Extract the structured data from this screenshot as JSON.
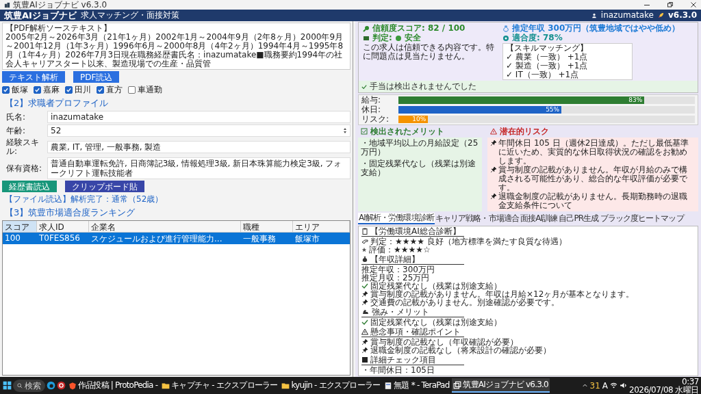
{
  "title_bar": {
    "title": "筑豊AIジョブナビ v6.3.0"
  },
  "header": {
    "title": "筑豊AIジョブナビ",
    "subtitle": "求人マッチング・面接対策",
    "user": "inazumatake",
    "version": "v6.3.0"
  },
  "source_text": {
    "heading": "【PDF解析ソーステキスト】",
    "body": "2005年2月～2026年3月（21年1ヶ月）2002年1月～2004年9月（2年8ヶ月）2000年9月～2001年12月（1年3ヶ月）1996年6月～2000年8月（4年2ヶ月）1994年4月～1995年8月（1年4ヶ月）2026年7月3日現在職務経歴書氏名：inazumatake■職務要約1994年の社会人キャリアスタート以来、製造現場での生産・品質管"
  },
  "source_buttons": [
    "テキスト解析",
    "PDF読込"
  ],
  "areas": [
    {
      "label": "飯塚",
      "checked": true
    },
    {
      "label": "嘉麻",
      "checked": true
    },
    {
      "label": "田川",
      "checked": true
    },
    {
      "label": "直方",
      "checked": true
    },
    {
      "label": "車通勤",
      "checked": false
    }
  ],
  "profile": {
    "heading": "【2】求職者プロファイル",
    "fields": [
      {
        "label": "氏名:",
        "value": "inazumatake",
        "kind": "text"
      },
      {
        "label": "年齢:",
        "value": "52",
        "kind": "spin"
      },
      {
        "label": "経験スキル:",
        "value": "農業, IT, 管理, 一般事務, 製造",
        "kind": "text"
      },
      {
        "label": "保有資格:",
        "value": "普通自動車運転免許, 日商簿記3級, 情報処理3級, 新日本珠算能力検定3級, フォークリフト運転技能者",
        "kind": "text"
      }
    ]
  },
  "profile_buttons": [
    {
      "label": "経歴書読込",
      "kind": "primary"
    },
    {
      "label": "クリップボード貼",
      "kind": "secondary"
    }
  ],
  "status": "【ファイル読込】解析完了：通常（52歳）",
  "ranking": {
    "heading": "【3】筑豊市場適合度ランキング",
    "columns": [
      "スコア",
      "求人ID",
      "企業名",
      "職種",
      "エリア"
    ],
    "rows": [
      {
        "cells": [
          "100",
          "T0FES856",
          "スケジュールおよび進行管理能力...",
          "一般事務",
          "飯塚市"
        ],
        "selected": true
      }
    ]
  },
  "trust": {
    "score": "信頼度スコア: 82 / 100",
    "verdict_label": "判定:",
    "verdict": "安全",
    "description": "この求人は信頼できる内容です。特に問題点は見当たりません。",
    "salary": "推定年収 300万円（筑豊地域ではやや低め）",
    "fit": "適合度: 78%",
    "skills": [
      "【スキルマッチング】",
      "✓ 農業（一致） +1点",
      "✓ 製造（一致） +1点",
      "✓ IT（一致） +1点"
    ],
    "allowance": "手当は検出されませんでした"
  },
  "meters": [
    {
      "label": "給与:",
      "level": 0.83,
      "reading": "83%",
      "color": "#2e7d32"
    },
    {
      "label": "休日:",
      "level": 0.55,
      "reading": "55%",
      "color": "#1e63c6"
    },
    {
      "label": "リスク:",
      "level": 0.1,
      "reading": "10%",
      "color": "#f59300"
    }
  ],
  "merits": {
    "heading": "検出されたメリット",
    "items": [
      "・地域平均以上の月給設定（25万円）",
      "・固定残業代なし（残業は別途支給）"
    ]
  },
  "risks": {
    "heading": "潜在的リスク",
    "items": [
      "年間休日 105 日（週休2日達成）。ただし最低基準に近いため、実質的な休日取得状況の確認をお勧めします。",
      "賞与制度の記載がありません。年収が月給のみで構成される可能性があり、総合的な年収評価が必要です。",
      "退職金制度の記載がありません。長期勤務時の退職金支給条件について"
    ]
  },
  "tabs": [
    {
      "label": "AI解析・労働環境診断",
      "selected": true
    },
    {
      "label": "キャリア戦略・市場適合",
      "selected": false
    },
    {
      "label": "面接AI訓練",
      "selected": false
    },
    {
      "label": "自己PR生成",
      "selected": false
    },
    {
      "label": "ブラック度ヒートマップ",
      "selected": false
    }
  ],
  "report": [
    {
      "kind": "title",
      "text": "【労働環境AI総合診断】"
    },
    {
      "kind": "rule"
    },
    {
      "kind": "verdict",
      "text": "判定：★★★★ 良好（地方標準を満たす良質な待遇）"
    },
    {
      "kind": "rating",
      "text": "評価：★★★★☆"
    },
    {
      "kind": "gap"
    },
    {
      "kind": "money",
      "text": "【年収詳細】"
    },
    {
      "kind": "rule"
    },
    {
      "kind": "plain",
      "text": "推定年収：300万円"
    },
    {
      "kind": "plain",
      "text": "推定月収：25万円"
    },
    {
      "kind": "check",
      "text": "固定残業代なし（残業は別途支給）"
    },
    {
      "kind": "pin",
      "text": "賞与制度の記載がありません。年収は月給×12ヶ月が基本となります。"
    },
    {
      "kind": "pin",
      "text": "交通費の記載がありません。別途確認が必要です。"
    },
    {
      "kind": "gap"
    },
    {
      "kind": "strength",
      "text": "強み・メリット"
    },
    {
      "kind": "rule"
    },
    {
      "kind": "check",
      "text": "固定残業代なし（残業は別途支給）"
    },
    {
      "kind": "gap"
    },
    {
      "kind": "warning",
      "text": "懸念事項・確認ポイント"
    },
    {
      "kind": "rule"
    },
    {
      "kind": "pin",
      "text": "賞与制度の記載なし（年収確認が必要）"
    },
    {
      "kind": "pin",
      "text": "退職金制度の記載なし（将来設計の確認が必要）"
    },
    {
      "kind": "gap"
    },
    {
      "kind": "square",
      "text": "詳細チェック項目"
    },
    {
      "kind": "rule"
    },
    {
      "kind": "plain",
      "text": "・年間休日：105日"
    }
  ],
  "taskbar": {
    "search_placeholder": "検索",
    "apps": [
      {
        "label": "作品投稿 | ProtoPedia -",
        "selected": false,
        "kind": "browser"
      },
      {
        "label": "キャプチャ - エクスプローラー",
        "selected": false,
        "kind": "folder"
      },
      {
        "label": "kyujin - エクスプローラー",
        "selected": false,
        "kind": "folder"
      },
      {
        "label": "無題 * - TeraPad",
        "selected": false,
        "kind": "editor"
      },
      {
        "label": "筑豊AIジョブナビ v6.3.0",
        "selected": true,
        "kind": "window"
      }
    ],
    "tray_badge": "31",
    "ime": "A",
    "time": "0:37",
    "date": "2026/07/08 水曜日"
  }
}
